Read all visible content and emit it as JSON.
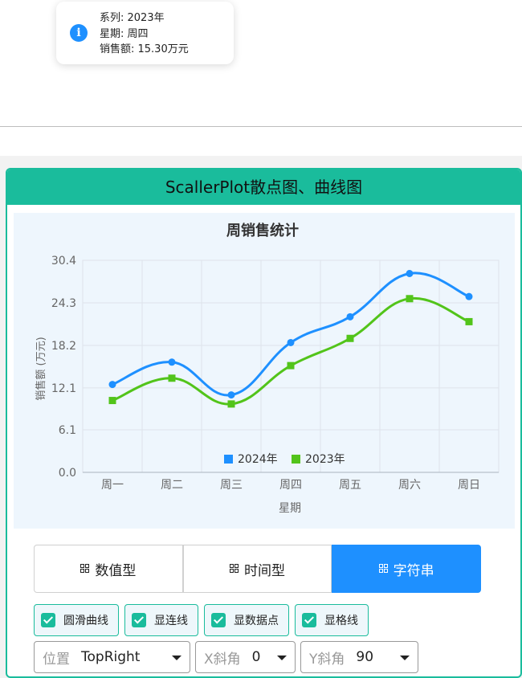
{
  "tooltip": {
    "series_line": "系列: 2023年",
    "day_line": "星期: 周四",
    "sales_line": "销售额: 15.30万元"
  },
  "panel": {
    "title": "ScallerPlot散点图、曲线图"
  },
  "chart_data": {
    "type": "line",
    "title": "周销售统计",
    "xlabel": "星期",
    "ylabel": "销售额 (万元)",
    "categories": [
      "周一",
      "周二",
      "周三",
      "周四",
      "周五",
      "周六",
      "周日"
    ],
    "yticks": [
      "0.0",
      "6.1",
      "12.1",
      "18.2",
      "24.3",
      "30.4"
    ],
    "ylim": [
      0,
      30.4
    ],
    "grid": true,
    "smooth": true,
    "legend_position": "bottom-center",
    "series": [
      {
        "name": "2024年",
        "color": "#1e90ff",
        "marker": "circle",
        "values": [
          12.6,
          15.8,
          11.1,
          18.6,
          22.3,
          28.5,
          25.2
        ]
      },
      {
        "name": "2023年",
        "color": "#52c41a",
        "marker": "square",
        "values": [
          10.3,
          13.5,
          9.8,
          15.3,
          19.2,
          24.9,
          21.6
        ]
      }
    ]
  },
  "tabs": [
    {
      "label": "数值型",
      "active": false
    },
    {
      "label": "时间型",
      "active": false
    },
    {
      "label": "字符串",
      "active": true
    }
  ],
  "checkboxes": [
    {
      "label": "圆滑曲线",
      "checked": true
    },
    {
      "label": "显连线",
      "checked": true
    },
    {
      "label": "显数据点",
      "checked": true
    },
    {
      "label": "显格线",
      "checked": true
    }
  ],
  "selects": {
    "position": {
      "label": "位置",
      "value": "TopRight"
    },
    "xangle": {
      "label": "X斜角",
      "value": "0"
    },
    "yangle": {
      "label": "Y斜角",
      "value": "90"
    }
  }
}
